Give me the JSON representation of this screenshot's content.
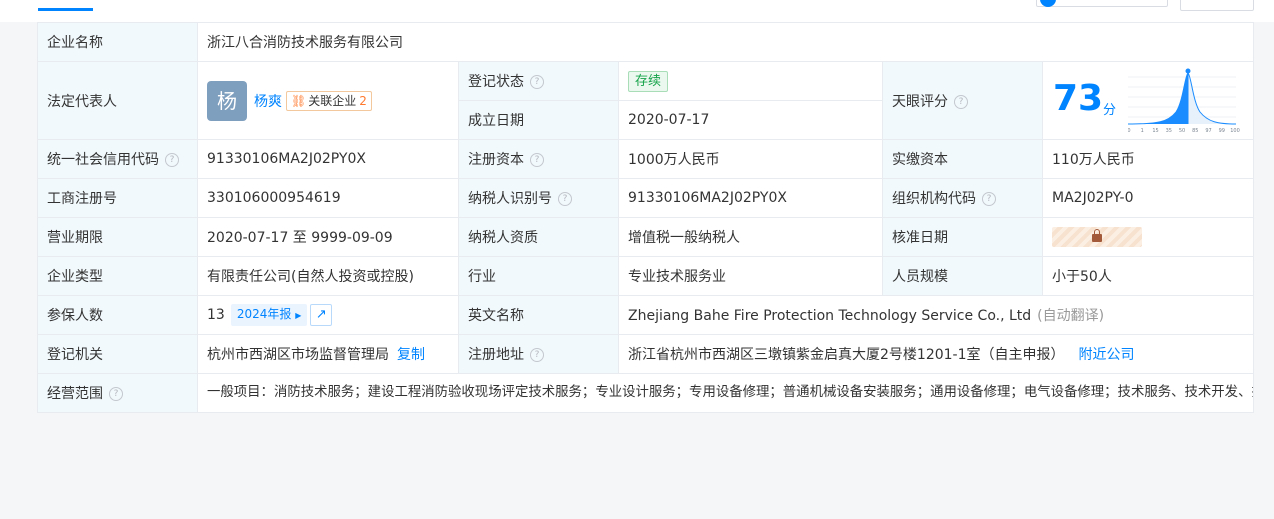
{
  "company_name_label": "企业名称",
  "company_name": "浙江八合消防技术服务有限公司",
  "legal_rep": {
    "label": "法定代表人",
    "avatar_char": "杨",
    "name": "杨爽",
    "related_label": "关联企业",
    "related_count": "2"
  },
  "reg_status": {
    "label": "登记状态",
    "value": "存续"
  },
  "found_date": {
    "label": "成立日期",
    "value": "2020-07-17"
  },
  "tianyan": {
    "label": "天眼评分",
    "score": "73",
    "unit": "分",
    "axis_ticks": [
      "0",
      "1",
      "15",
      "35",
      "50",
      "85",
      "97",
      "99",
      "100"
    ]
  },
  "credit_code": {
    "label": "统一社会信用代码",
    "value": "91330106MA2J02PY0X"
  },
  "reg_capital": {
    "label": "注册资本",
    "value": "1000万人民币"
  },
  "paid_capital": {
    "label": "实缴资本",
    "value": "110万人民币"
  },
  "biz_reg_no": {
    "label": "工商注册号",
    "value": "330106000954619"
  },
  "taxpayer_id": {
    "label": "纳税人识别号",
    "value": "91330106MA2J02PY0X"
  },
  "org_code": {
    "label": "组织机构代码",
    "value": "MA2J02PY-0"
  },
  "biz_term": {
    "label": "营业期限",
    "value": "2020-07-17 至 9999-09-09"
  },
  "taxpayer_qual": {
    "label": "纳税人资质",
    "value": "增值税一般纳税人"
  },
  "approve_date": {
    "label": "核准日期"
  },
  "company_type": {
    "label": "企业类型",
    "value": "有限责任公司(自然人投资或控股)"
  },
  "industry": {
    "label": "行业",
    "value": "专业技术服务业"
  },
  "staff_size": {
    "label": "人员规模",
    "value": "小于50人"
  },
  "insured": {
    "label": "参保人数",
    "value": "13",
    "report_label": "2024年报"
  },
  "english_name": {
    "label": "英文名称",
    "value": "Zhejiang Bahe Fire Protection Technology Service Co., Ltd",
    "note": "(自动翻译)"
  },
  "reg_authority": {
    "label": "登记机关",
    "value": "杭州市西湖区市场监督管理局",
    "copy_label": "复制"
  },
  "reg_address": {
    "label": "注册地址",
    "value": "浙江省杭州市西湖区三墩镇紫金启真大厦2号楼1201-1室（自主申报）",
    "nearby_label": "附近公司"
  },
  "business_scope": {
    "label": "经营范围",
    "value": "一般项目：消防技术服务；建设工程消防验收现场评定技术服务；专业设计服务；专用设备修理；普通机械设备安装服务；通用设备修理；电气设备修理；技术服务、技术开发、技术咨询、技术交流、技术转让、技术推广；软件开发；消防器材销售；安防设备销售；建筑材料销售；五金产品零售；电线、电缆经营；建筑装饰材料销售；机械电气设备销售；制冷、空调设备销售；工程管理服务；市政设施管理；安全系统监控服务(除依法须经批准的项目外，凭营业执照依法自主开展经营活动)。许可项目：施工专业作业(依法须经批准的项目，经相关部门批准后方可开展经营活动，具体经营项目以审批结果为准)。"
  },
  "help_icon": "?",
  "colors": {
    "accent": "#0084ff",
    "label_bg": "#f2f9fc",
    "status_green": "#16a34a",
    "orange": "#ff7a2f"
  }
}
